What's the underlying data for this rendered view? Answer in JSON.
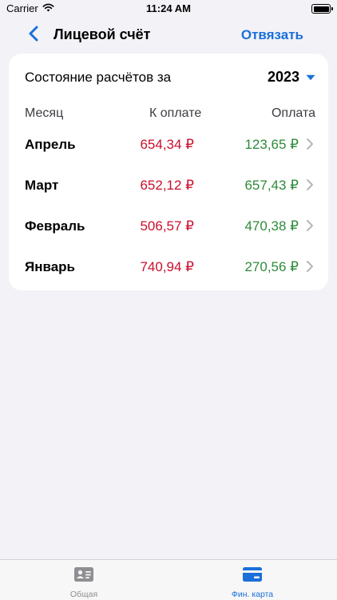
{
  "status_bar": {
    "carrier": "Carrier",
    "time": "11:24 AM"
  },
  "nav": {
    "title": "Лицевой счёт",
    "unlink_label": "Отвязать",
    "back_icon": "chevron-left-icon"
  },
  "card": {
    "period_label": "Состояние расчётов за",
    "year": "2023",
    "columns": {
      "month": "Месяц",
      "due": "К оплате",
      "paid": "Оплата"
    },
    "rows": [
      {
        "month": "Апрель",
        "due": "654,34 ₽",
        "paid": "123,65 ₽"
      },
      {
        "month": "Март",
        "due": "652,12 ₽",
        "paid": "657,43 ₽"
      },
      {
        "month": "Февраль",
        "due": "506,57 ₽",
        "paid": "470,38 ₽"
      },
      {
        "month": "Январь",
        "due": "740,94 ₽",
        "paid": "270,56 ₽"
      }
    ]
  },
  "tab_bar": {
    "tabs": [
      {
        "label": "Общая",
        "icon": "contact-card-icon",
        "active": false
      },
      {
        "label": "Фин. карта",
        "icon": "credit-card-icon",
        "active": true
      }
    ]
  },
  "colors": {
    "accent": "#1a6fd9",
    "due_red": "#c8102e",
    "paid_green": "#2e8b3a",
    "background": "#f2f2f7"
  }
}
